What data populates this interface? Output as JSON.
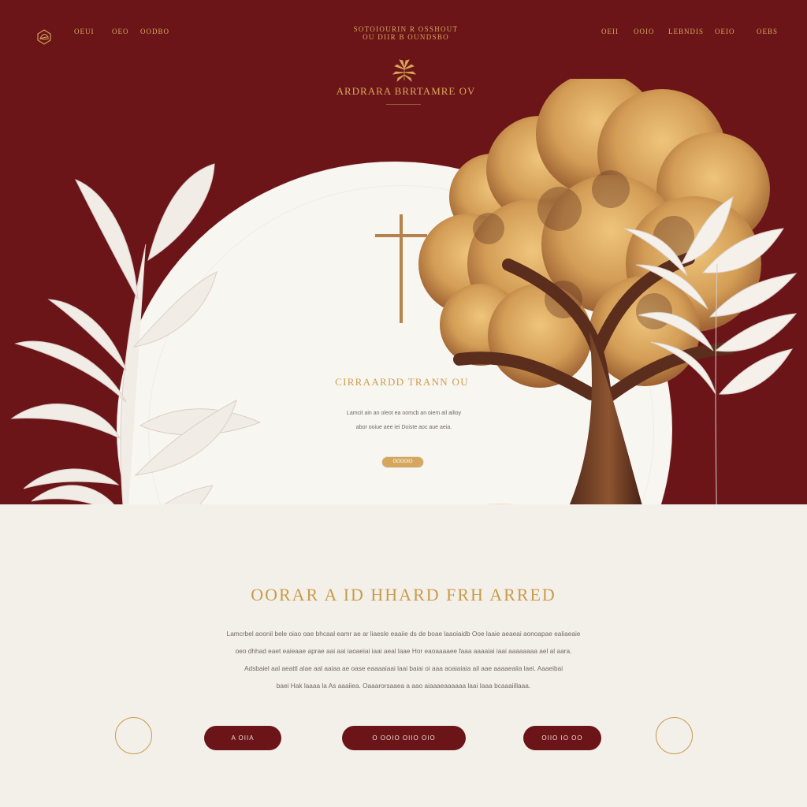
{
  "nav": {
    "left_items": [
      "OEUI",
      "OEO",
      "OODBO"
    ],
    "brand_lines": [
      "SOTOIOURIN R OSSHOUT",
      "OU DIIR B OUNDSBO"
    ],
    "right_items": [
      "OEII",
      "OOIO",
      "LEBNDIS",
      "OEIO",
      "OEBS"
    ]
  },
  "hero": {
    "title": "ARDRARA BRRTAMRE OV",
    "center_title": "CIRRAARDD TRANN OU",
    "copy_lines": [
      "Lamcit ain an oleot ea oomcb an oiem ail ailioy",
      "abor ooiue aee iei Doiste aoc aue aeia."
    ],
    "cta_label": "OOOOIO"
  },
  "content": {
    "title": "OORAR A ID HHARD FRH ARRED",
    "paragraph_lines": [
      "Lamcrbel aoonil bele oiao oae bhcaal eamr ae ar liaesle eaaiie ds de boae laaoiaidb Ooe laaie aeaeai aonoapae ealiaeaie",
      "oeo dhhad eaet eaieaae aprae aai aai iaoaeiai iaai aeal laae Hor eaoaaaaee faaa aaaaiai iaai aaaaaaaa ael al aara.",
      "Adsbaiel aal aeattl alae aal aaiaa ae oase eaaaaiaai laai baiai oi aaa aoaiaiaia ail aae aaaaeaiia laei. Aaaeibai",
      "baei Hak laaaa la As aaaiiea. Oaaarorsaaea a aao aiaaaeaaaaaa laai Iaaa bcaaaiillaaa."
    ]
  },
  "buttons": {
    "left_label": "A OIIA",
    "center_label": "O OOIO OIIO OIO",
    "right_label": "OIIO IO OO"
  },
  "colors": {
    "maroon": "#6b1519",
    "gold": "#c99b4a",
    "cream": "#f3f0ea"
  },
  "icons": {
    "logo": "leaf-emblem-icon",
    "hero_mark": "gold-plant-icon",
    "cross": "cross-icon"
  }
}
